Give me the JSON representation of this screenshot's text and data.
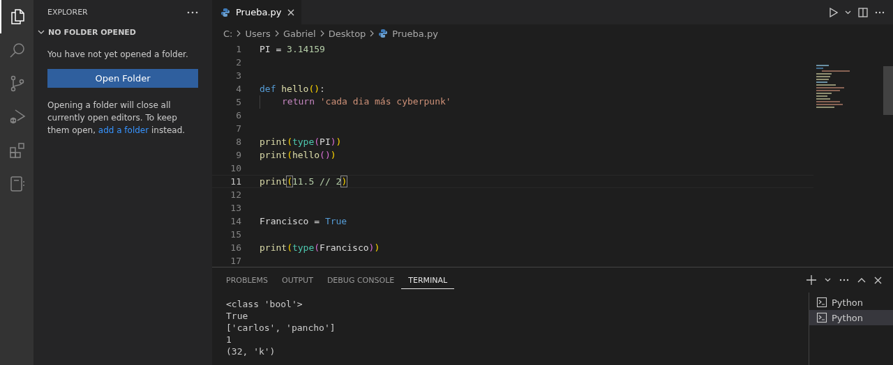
{
  "sidebar": {
    "title": "EXPLORER",
    "section": {
      "title": "NO FOLDER OPENED",
      "expanded": true
    },
    "message": "You have not yet opened a folder.",
    "button": "Open Folder",
    "note": {
      "before": "Opening a folder will close all currently open editors. To keep them open, ",
      "link": "add a folder",
      "after": " instead."
    }
  },
  "activity_bar": [
    {
      "kind": "files",
      "selected": true
    },
    {
      "kind": "search",
      "selected": false
    },
    {
      "kind": "source-control",
      "selected": false
    },
    {
      "kind": "run-debug",
      "selected": false
    },
    {
      "kind": "extensions",
      "selected": false
    },
    {
      "kind": "notebook",
      "selected": false
    }
  ],
  "tabs": [
    {
      "label": "Prueba.py",
      "selected": true
    }
  ],
  "breadcrumb": [
    "C:",
    "Users",
    "Gabriel",
    "Desktop",
    "Prueba.py"
  ],
  "code_lines": [
    {
      "number": "1",
      "current": false,
      "tokens": [
        {
          "text": "PI =",
          "kind": "var"
        },
        {
          "text": "3.14159",
          "kind": "number",
          "space": true
        }
      ]
    },
    {
      "number": "2",
      "current": false
    },
    {
      "number": "3",
      "current": false
    },
    {
      "number": "4",
      "current": false,
      "tokens": [
        {
          "text": "def",
          "kind": "keyword"
        },
        {
          "text": "hello",
          "kind": "func",
          "space": true
        },
        {
          "text": "()",
          "kind": "bracket1"
        },
        {
          "text": ":",
          "kind": "op"
        }
      ]
    },
    {
      "number": "5",
      "current": false,
      "indented": true,
      "tokens": [
        {
          "text": "return",
          "kind": "control"
        },
        {
          "text": "'cada dia más cyberpunk'",
          "kind": "string",
          "space": true
        }
      ]
    },
    {
      "number": "6",
      "current": false
    },
    {
      "number": "7",
      "current": false
    },
    {
      "number": "8",
      "current": false,
      "tokens": [
        {
          "text": "print",
          "kind": "func"
        },
        {
          "text": "(",
          "kind": "bracket1"
        },
        {
          "text": "type",
          "kind": "type"
        },
        {
          "text": "(",
          "kind": "bracket2"
        },
        {
          "text": "PI",
          "kind": "var"
        },
        {
          "text": ")",
          "kind": "bracket2"
        },
        {
          "text": ")",
          "kind": "bracket1"
        }
      ]
    },
    {
      "number": "9",
      "current": false,
      "tokens": [
        {
          "text": "print",
          "kind": "func"
        },
        {
          "text": "(",
          "kind": "bracket1"
        },
        {
          "text": "hello",
          "kind": "func"
        },
        {
          "text": "()",
          "kind": "bracket2"
        },
        {
          "text": ")",
          "kind": "bracket1"
        }
      ]
    },
    {
      "number": "10",
      "current": false
    },
    {
      "number": "11",
      "current": true,
      "tokens": [
        {
          "text": "print",
          "kind": "func"
        },
        {
          "text": "(",
          "kind": "bracket1-match"
        },
        {
          "text": "11.5 // 2",
          "kind": "number"
        },
        {
          "text": ")",
          "kind": "bracket1-match"
        }
      ]
    },
    {
      "number": "12",
      "current": false
    },
    {
      "number": "13",
      "current": false
    },
    {
      "number": "14",
      "current": false,
      "tokens": [
        {
          "text": "Francisco =",
          "kind": "var"
        },
        {
          "text": "True",
          "kind": "keyword",
          "space": true
        }
      ]
    },
    {
      "number": "15",
      "current": false
    },
    {
      "number": "16",
      "current": false,
      "tokens": [
        {
          "text": "print",
          "kind": "func"
        },
        {
          "text": "(",
          "kind": "bracket1"
        },
        {
          "text": "type",
          "kind": "type"
        },
        {
          "text": "(",
          "kind": "bracket2"
        },
        {
          "text": "Francisco",
          "kind": "var"
        },
        {
          "text": ")",
          "kind": "bracket2"
        },
        {
          "text": ")",
          "kind": "bracket1"
        }
      ]
    },
    {
      "number": "17",
      "current": false
    }
  ],
  "panel": {
    "tabs": [
      {
        "label": "PROBLEMS",
        "selected": false
      },
      {
        "label": "OUTPUT",
        "selected": false
      },
      {
        "label": "DEBUG CONSOLE",
        "selected": false
      },
      {
        "label": "TERMINAL",
        "selected": true
      }
    ],
    "terminal_lines": [
      "<class 'bool'>",
      "True",
      "['carlos', 'pancho']",
      "1",
      "(32, 'k')"
    ],
    "terminals": [
      {
        "label": "Python",
        "selected": false
      },
      {
        "label": "Python",
        "selected": true
      }
    ]
  }
}
